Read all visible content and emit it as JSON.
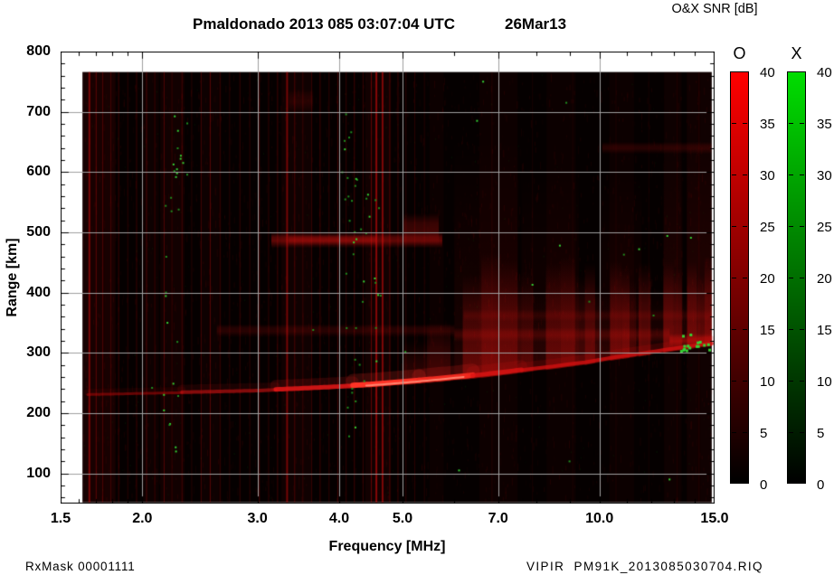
{
  "title": {
    "main": "Pmaldonado 2013 085 03:07:04 UTC",
    "date": "26Mar13"
  },
  "header": {
    "snr": "O&X SNR [dB]"
  },
  "footer": {
    "left": "RxMask 00001111",
    "right": "VIPIR  PM91K_2013085030704.RIQ"
  },
  "chart_data": {
    "type": "heatmap",
    "title": "Pmaldonado 2013 085 03:07:04 UTC 26Mar13",
    "xlabel": "Frequency [MHz]",
    "ylabel": "Range [km]",
    "x_scale": "log",
    "xlim": [
      1.5,
      15
    ],
    "ylim": [
      50,
      800
    ],
    "x_ticks": [
      {
        "v": 1.5,
        "label": "1.5"
      },
      {
        "v": 2,
        "label": "2.0"
      },
      {
        "v": 3,
        "label": "3.0"
      },
      {
        "v": 4,
        "label": "4.0"
      },
      {
        "v": 5,
        "label": "5.0"
      },
      {
        "v": 7,
        "label": "7.0"
      },
      {
        "v": 10,
        "label": "10.0"
      },
      {
        "v": 15,
        "label": "15.0"
      }
    ],
    "x_minor_ticks": [
      1.6,
      1.7,
      1.8,
      1.9,
      6,
      8,
      9,
      11,
      12,
      13,
      14
    ],
    "y_ticks": [
      100,
      200,
      300,
      400,
      500,
      600,
      700,
      800
    ],
    "y_minor_step": 20,
    "grid": {
      "color": "#a0a0a0",
      "x_values": [
        2,
        3,
        4,
        5,
        7,
        10
      ],
      "y_values": [
        100,
        200,
        300,
        400,
        500,
        600,
        700
      ]
    },
    "colorbars": [
      {
        "label": "O",
        "min": 0,
        "max": 40,
        "step": 5,
        "color": "#ff0000",
        "unit": "dB"
      },
      {
        "label": "X",
        "min": 0,
        "max": 40,
        "step": 5,
        "color": "#00dd00",
        "unit": "dB"
      }
    ],
    "features": {
      "data_extent": {
        "f": [
          1.62,
          14.85
        ],
        "range": [
          52,
          766
        ]
      },
      "noise": {
        "seed": 42,
        "red_count": 2800,
        "green_count": 220
      },
      "rfi_bands": [
        [
          1.62,
          1.82,
          0.1
        ],
        [
          2.0,
          2.12,
          0.05
        ],
        [
          2.13,
          2.32,
          0.07
        ],
        [
          2.46,
          2.64,
          0.05
        ],
        [
          3.26,
          3.64,
          0.06
        ],
        [
          4.38,
          4.8,
          0.07
        ],
        [
          5.5,
          5.78,
          0.04
        ],
        [
          6.55,
          7.5,
          0.045
        ],
        [
          8.3,
          9.2,
          0.04
        ],
        [
          10.35,
          11.3,
          0.04
        ],
        [
          12.55,
          13.35,
          0.05
        ],
        [
          13.6,
          14.85,
          0.06
        ]
      ],
      "rfi_lines": [
        [
          1.66,
          0.5,
          2
        ],
        [
          1.7,
          0.38,
          1
        ],
        [
          1.74,
          0.3,
          1
        ],
        [
          1.79,
          0.22,
          1
        ],
        [
          1.84,
          0.26,
          1
        ],
        [
          1.9,
          0.18,
          1
        ],
        [
          1.96,
          0.24,
          1
        ],
        [
          2.03,
          0.32,
          1
        ],
        [
          2.09,
          0.2,
          1
        ],
        [
          2.16,
          0.3,
          1
        ],
        [
          2.22,
          0.18,
          1
        ],
        [
          2.3,
          0.26,
          1
        ],
        [
          2.38,
          0.16,
          1
        ],
        [
          2.46,
          0.3,
          1
        ],
        [
          2.54,
          0.38,
          1
        ],
        [
          2.63,
          0.2,
          1
        ],
        [
          2.72,
          0.16,
          1
        ],
        [
          2.82,
          0.24,
          1
        ],
        [
          2.92,
          0.18,
          1
        ],
        [
          3.02,
          0.32,
          1
        ],
        [
          3.12,
          0.2,
          1
        ],
        [
          3.22,
          0.28,
          1
        ],
        [
          3.33,
          0.5,
          2
        ],
        [
          3.42,
          0.3,
          1
        ],
        [
          3.52,
          0.22,
          1
        ],
        [
          3.63,
          0.18,
          1
        ],
        [
          3.74,
          0.26,
          1
        ],
        [
          3.86,
          0.2,
          1
        ],
        [
          3.98,
          0.3,
          1
        ],
        [
          4.1,
          0.22,
          1
        ],
        [
          4.22,
          0.28,
          1
        ],
        [
          4.35,
          0.26,
          1
        ],
        [
          4.48,
          0.42,
          1
        ],
        [
          4.56,
          0.6,
          2
        ],
        [
          4.66,
          0.55,
          2
        ],
        [
          4.78,
          0.32,
          1
        ],
        [
          4.92,
          0.26,
          1
        ],
        [
          5.06,
          0.2,
          1
        ],
        [
          5.22,
          0.18,
          1
        ],
        [
          5.4,
          0.15,
          1
        ],
        [
          6.85,
          0.1,
          1
        ],
        [
          7.9,
          0.09,
          1
        ],
        [
          9.1,
          0.08,
          1
        ],
        [
          10.6,
          0.08,
          1
        ],
        [
          11.9,
          0.08,
          1
        ],
        [
          13.15,
          0.1,
          1
        ],
        [
          14.2,
          0.1,
          1
        ]
      ],
      "echo_cutoff": [
        [
          1.62,
          227
        ],
        [
          2,
          229
        ],
        [
          2.5,
          231
        ],
        [
          3,
          233
        ],
        [
          3.5,
          236
        ],
        [
          4,
          239
        ],
        [
          4.5,
          242
        ],
        [
          5,
          246
        ],
        [
          5.5,
          250
        ],
        [
          6,
          254
        ],
        [
          6.5,
          258
        ],
        [
          7,
          262
        ],
        [
          7.5,
          266
        ],
        [
          8,
          270
        ],
        [
          8.5,
          273
        ],
        [
          9,
          277
        ],
        [
          9.5,
          280
        ],
        [
          10,
          284
        ],
        [
          10.5,
          288
        ],
        [
          11,
          291
        ],
        [
          11.5,
          294
        ],
        [
          12,
          297
        ],
        [
          12.5,
          300
        ],
        [
          13,
          303
        ],
        [
          13.5,
          305
        ],
        [
          14,
          308
        ],
        [
          14.5,
          310
        ],
        [
          14.85,
          311
        ]
      ],
      "diffuse_columns": [
        [
          5.0,
          5.45,
          320,
          0.22
        ],
        [
          5.45,
          5.92,
          352,
          0.3
        ],
        [
          5.92,
          6.18,
          330,
          0.1
        ],
        [
          6.18,
          6.6,
          430,
          0.42
        ],
        [
          6.6,
          7.05,
          465,
          0.52
        ],
        [
          7.05,
          7.5,
          455,
          0.46
        ],
        [
          7.5,
          7.92,
          435,
          0.36
        ],
        [
          7.92,
          8.28,
          395,
          0.12
        ],
        [
          8.28,
          8.72,
          450,
          0.42
        ],
        [
          8.72,
          9.18,
          460,
          0.48
        ],
        [
          9.18,
          9.5,
          430,
          0.32
        ],
        [
          9.5,
          9.85,
          450,
          0.5
        ],
        [
          9.85,
          10.08,
          415,
          0.26
        ],
        [
          10.08,
          10.38,
          395,
          0.12
        ],
        [
          10.38,
          10.82,
          452,
          0.48
        ],
        [
          10.82,
          11.12,
          442,
          0.52
        ],
        [
          11.12,
          11.38,
          420,
          0.28
        ],
        [
          11.38,
          11.48,
          400,
          0.1
        ],
        [
          11.48,
          11.98,
          450,
          0.46
        ],
        [
          11.98,
          12.52,
          408,
          0.13
        ],
        [
          12.52,
          12.98,
          452,
          0.48
        ],
        [
          12.98,
          13.38,
          440,
          0.42
        ],
        [
          13.38,
          13.62,
          400,
          0.16
        ],
        [
          13.62,
          14.08,
          452,
          0.48
        ],
        [
          14.08,
          14.48,
          430,
          0.38
        ],
        [
          14.48,
          14.85,
          460,
          0.5
        ]
      ],
      "haze_columns": [
        [
          6.0,
          7.5,
          660,
          0.1
        ],
        [
          7.6,
          9.3,
          620,
          0.08
        ],
        [
          10.05,
          11.6,
          600,
          0.08
        ],
        [
          12.52,
          13.4,
          645,
          0.1
        ],
        [
          13.6,
          14.85,
          665,
          0.11
        ]
      ],
      "bands": [
        [
          3.15,
          5.75,
          474,
          500,
          0.42
        ],
        [
          3.35,
          4.55,
          478,
          496,
          0.3
        ],
        [
          5.0,
          5.68,
          478,
          532,
          0.26
        ],
        [
          2.6,
          6.0,
          326,
          348,
          0.17
        ],
        [
          6.0,
          12.8,
          318,
          342,
          0.2
        ],
        [
          12.8,
          14.85,
          310,
          332,
          0.45
        ],
        [
          10.1,
          14.85,
          630,
          650,
          0.16
        ],
        [
          3.35,
          3.65,
          698,
          738,
          0.12
        ],
        [
          6.2,
          14.85,
          352,
          372,
          0.12
        ]
      ],
      "trace": [
        [
          1.65,
          2.3,
          0.5,
          3,
          "#b40a0a"
        ],
        [
          2.3,
          3.2,
          0.6,
          4,
          "#c81212"
        ],
        [
          3.2,
          4.2,
          0.85,
          5,
          "#e61717"
        ],
        [
          4.2,
          5.3,
          1,
          6,
          "#ff3326"
        ],
        [
          5.3,
          6.4,
          0.95,
          6,
          "#f52b20"
        ],
        [
          6.4,
          7.6,
          0.8,
          5,
          "#dd1414"
        ],
        [
          7.6,
          14.85,
          0.8,
          4,
          "#cf1010"
        ]
      ],
      "trace_core": [
        [
          4.4,
          6.2,
          0.9,
          2,
          "#ff8d78"
        ]
      ],
      "green_columns": [
        [
          2.22,
          120,
          740,
          20
        ],
        [
          2.3,
          480,
          745,
          10
        ],
        [
          4.15,
          140,
          700,
          24
        ],
        [
          4.3,
          200,
          620,
          12
        ],
        [
          4.5,
          250,
          560,
          9
        ]
      ],
      "green_cluster": [
        13.2,
        14.85,
        300,
        332,
        16
      ],
      "green_singles": [
        [
          6.64,
          750
        ],
        [
          8.9,
          715
        ],
        [
          6.5,
          685
        ],
        [
          8.7,
          478
        ],
        [
          10.9,
          463
        ],
        [
          11.5,
          472
        ],
        [
          12.7,
          494
        ],
        [
          13.8,
          491
        ],
        [
          7.9,
          413
        ],
        [
          9.65,
          385
        ],
        [
          12.1,
          362
        ],
        [
          5.05,
          302
        ],
        [
          2.07,
          242
        ],
        [
          3.65,
          338
        ],
        [
          6.1,
          105
        ],
        [
          9.0,
          120
        ],
        [
          12.8,
          90
        ]
      ]
    }
  }
}
